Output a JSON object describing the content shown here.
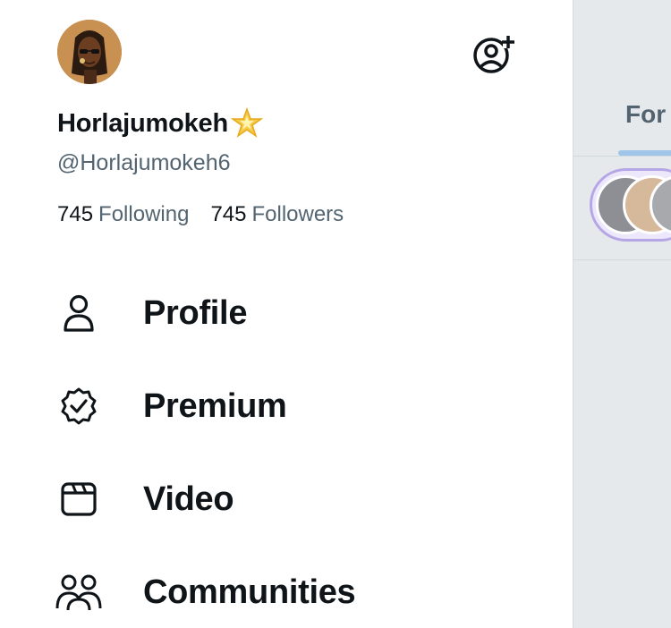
{
  "profile": {
    "display_name": "Horlajumokeh",
    "badge_emoji": "star-emoji",
    "handle": "@Horlajumokeh6",
    "following_count": "745",
    "following_label": "Following",
    "followers_count": "745",
    "followers_label": "Followers"
  },
  "menu": [
    {
      "label": "Profile",
      "icon": "person-icon"
    },
    {
      "label": "Premium",
      "icon": "verified-badge-icon"
    },
    {
      "label": "Video",
      "icon": "video-icon"
    },
    {
      "label": "Communities",
      "icon": "communities-icon"
    }
  ],
  "right_pane": {
    "tab_label": "For y"
  },
  "colors": {
    "text_primary": "#0f1419",
    "text_secondary": "#536471",
    "tab_indicator": "#9fc5e8",
    "fleet_ring": "#b7a6e6"
  }
}
